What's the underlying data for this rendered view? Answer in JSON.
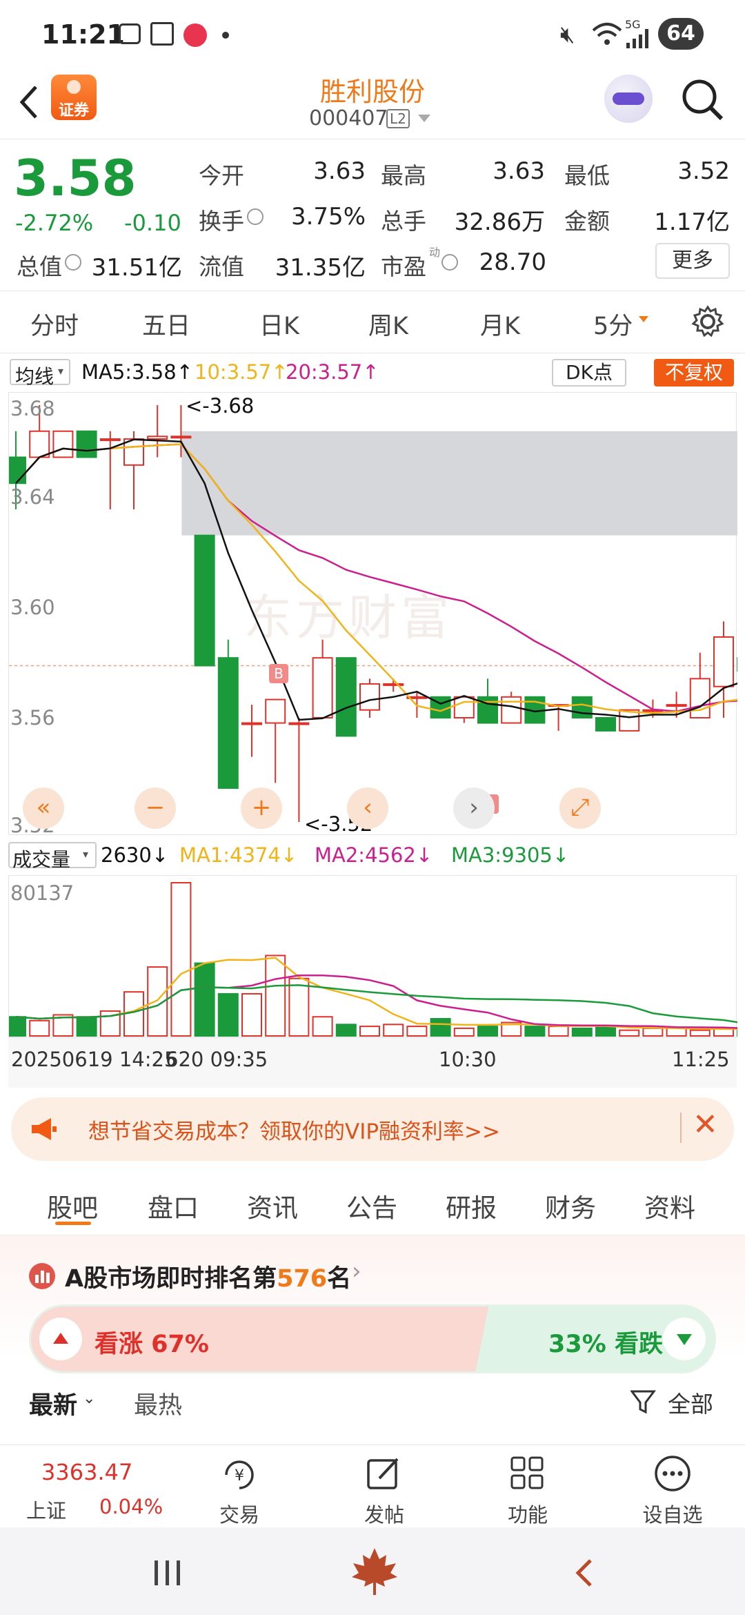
{
  "status_bar": {
    "time": "11:21",
    "battery": "64",
    "network": "5G"
  },
  "header": {
    "title": "胜利股份",
    "code": "000407",
    "level": "L2",
    "logo_text": "证券"
  },
  "quote": {
    "price": "3.58",
    "change_pct": "-2.72%",
    "change": "-0.10",
    "open_label": "今开",
    "open": "3.63",
    "high_label": "最高",
    "high": "3.63",
    "low_label": "最低",
    "low": "3.52",
    "turnover_label": "换手",
    "turnover": "3.75%",
    "volume_label": "总手",
    "volume": "32.86万",
    "amount_label": "金额",
    "amount": "1.17亿",
    "mcap_label": "总值",
    "mcap": "31.51亿",
    "float_label": "流值",
    "float": "31.35亿",
    "pe_label": "市盈",
    "pe_sup": "动",
    "pe": "28.70",
    "more": "更多"
  },
  "period_tabs": [
    "分时",
    "五日",
    "日K",
    "周K",
    "月K",
    "5分"
  ],
  "kline": {
    "ma_selector": "均线",
    "ma5": "MA5:3.58",
    "ma10": "10:3.57",
    "ma20": "20:3.57",
    "dk": "DK点",
    "adjust": "不复权",
    "y_labels": [
      "3.68",
      "3.64",
      "3.60",
      "3.56",
      "3.52"
    ],
    "max_label": "<-3.68",
    "min_label": "<-3.52",
    "marker": "B",
    "watermark": "东方财富"
  },
  "volume": {
    "selector": "成交量",
    "current": "2630",
    "ma1": "MA1:4374",
    "ma2": "MA2:4562",
    "ma3": "MA3:9305",
    "max_label": "80137",
    "x_labels": {
      "start": "20250619 14:25",
      "start_tail": "620 09:35",
      "mid": "10:30",
      "end": "11:25"
    }
  },
  "chart_controls": [
    "«",
    "−",
    "+",
    "‹",
    "›",
    "⤢"
  ],
  "colors": {
    "up": "#e0302a",
    "down": "#1a9a3a",
    "accent": "#f07a1a",
    "ma5": "#111111",
    "ma10": "#f0b419",
    "ma20": "#cc1f8f"
  },
  "chart_data": [
    {
      "type": "candlestick",
      "interval": "5分",
      "ylim": [
        3.52,
        3.68
      ],
      "ma5": "MA5:3.58",
      "ma10": "10:3.57",
      "ma20": "20:3.57",
      "candles": [
        {
          "o": 3.66,
          "c": 3.65,
          "h": 3.67,
          "l": 3.64
        },
        {
          "o": 3.66,
          "c": 3.67,
          "h": 3.68,
          "l": 3.66
        },
        {
          "o": 3.66,
          "c": 3.67,
          "h": 3.67,
          "l": 3.66
        },
        {
          "o": 3.67,
          "c": 3.66,
          "h": 3.67,
          "l": 3.66
        },
        {
          "o": 3.667,
          "c": 3.667,
          "h": 3.67,
          "l": 3.64
        },
        {
          "o": 3.657,
          "c": 3.667,
          "h": 3.67,
          "l": 3.64
        },
        {
          "o": 3.667,
          "c": 3.668,
          "h": 3.68,
          "l": 3.66
        },
        {
          "o": 3.668,
          "c": 3.668,
          "h": 3.68,
          "l": 3.66
        },
        {
          "o": 3.63,
          "c": 3.58,
          "h": 3.63,
          "l": 3.58
        },
        {
          "o": 3.583,
          "c": 3.533,
          "h": 3.59,
          "l": 3.535
        },
        {
          "o": 3.558,
          "c": 3.558,
          "h": 3.565,
          "l": 3.545
        },
        {
          "o": 3.558,
          "c": 3.567,
          "h": 3.567,
          "l": 3.535
        },
        {
          "o": 3.558,
          "c": 3.558,
          "h": 3.56,
          "l": 3.52
        },
        {
          "o": 3.56,
          "c": 3.583,
          "h": 3.59,
          "l": 3.56
        },
        {
          "o": 3.583,
          "c": 3.553,
          "h": 3.583,
          "l": 3.553
        },
        {
          "o": 3.563,
          "c": 3.573,
          "h": 3.575,
          "l": 3.56
        },
        {
          "o": 3.573,
          "c": 3.573,
          "h": 3.575,
          "l": 3.57
        },
        {
          "o": 3.568,
          "c": 3.568,
          "h": 3.57,
          "l": 3.56
        },
        {
          "o": 3.568,
          "c": 3.56,
          "h": 3.568,
          "l": 3.56
        },
        {
          "o": 3.56,
          "c": 3.568,
          "h": 3.568,
          "l": 3.558
        },
        {
          "o": 3.568,
          "c": 3.558,
          "h": 3.575,
          "l": 3.558
        },
        {
          "o": 3.558,
          "c": 3.568,
          "h": 3.57,
          "l": 3.558
        },
        {
          "o": 3.568,
          "c": 3.558,
          "h": 3.568,
          "l": 3.558
        },
        {
          "o": 3.565,
          "c": 3.565,
          "h": 3.565,
          "l": 3.555
        },
        {
          "o": 3.568,
          "c": 3.56,
          "h": 3.568,
          "l": 3.56
        },
        {
          "o": 3.56,
          "c": 3.555,
          "h": 3.56,
          "l": 3.555
        },
        {
          "o": 3.555,
          "c": 3.563,
          "h": 3.563,
          "l": 3.555
        },
        {
          "o": 3.563,
          "c": 3.563,
          "h": 3.567,
          "l": 3.56
        },
        {
          "o": 3.565,
          "c": 3.565,
          "h": 3.57,
          "l": 3.56
        },
        {
          "o": 3.56,
          "c": 3.575,
          "h": 3.585,
          "l": 3.56
        },
        {
          "o": 3.572,
          "c": 3.591,
          "h": 3.597,
          "l": 3.56
        },
        {
          "o": 3.583,
          "c": 3.578,
          "h": 3.583,
          "l": 3.575
        },
        {
          "o": 3.58,
          "c": 3.58,
          "h": 3.583,
          "l": 3.57
        }
      ],
      "volumes": [
        10,
        8,
        11,
        10,
        13,
        23,
        36,
        80,
        38,
        22,
        22,
        42,
        30,
        10,
        6,
        5,
        6,
        5,
        9,
        4,
        5,
        7,
        5,
        5,
        4,
        5,
        3,
        4,
        4,
        3,
        4,
        3,
        3
      ]
    }
  ],
  "banner": {
    "text": "想节省交易成本？领取你的VIP融资利率>>"
  },
  "sub_tabs": [
    "股吧",
    "盘口",
    "资讯",
    "公告",
    "研报",
    "财务",
    "资料"
  ],
  "ranking": {
    "prefix": "A股市场即时排名第",
    "rank": "576",
    "suffix": "名"
  },
  "sentiment": {
    "up_label": "看涨 67%",
    "down_label": "33% 看跌",
    "up_pct": 67
  },
  "feed": {
    "tab_latest": "最新",
    "tab_hot": "最热",
    "filter": "全部"
  },
  "bottom_nav": {
    "index_value": "3363.47",
    "index_name": "上证",
    "index_change": "0.04%",
    "items": [
      "交易",
      "发帖",
      "功能",
      "设自选"
    ]
  }
}
